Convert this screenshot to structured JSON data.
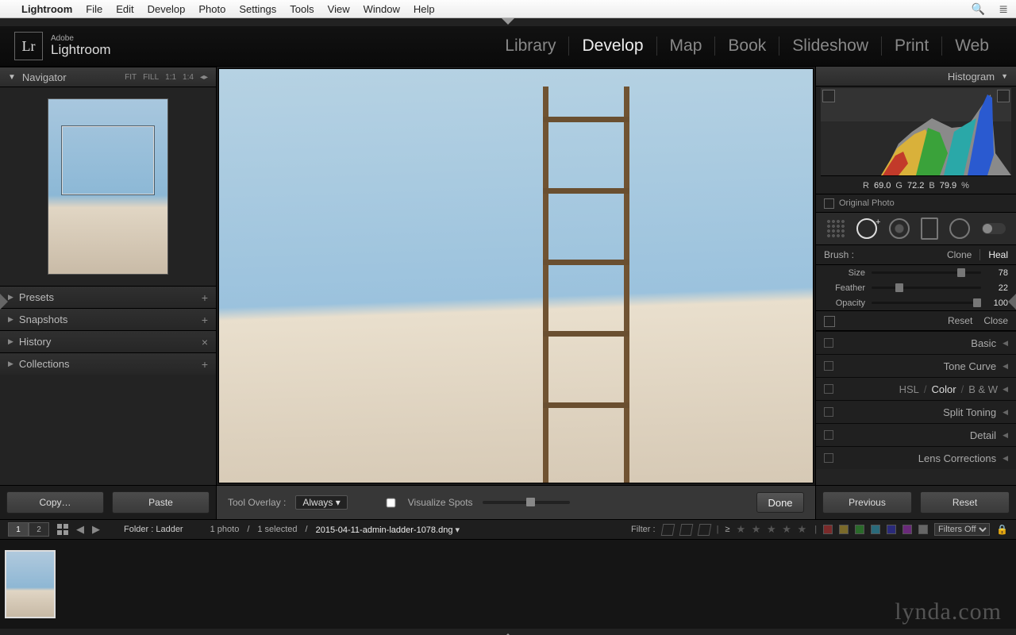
{
  "menubar": {
    "app": "Lightroom",
    "items": [
      "File",
      "Edit",
      "Develop",
      "Photo",
      "Settings",
      "Tools",
      "View",
      "Window",
      "Help"
    ]
  },
  "identity": {
    "adobe": "Adobe",
    "product": "Lightroom",
    "mark": "Lr"
  },
  "modules": [
    "Library",
    "Develop",
    "Map",
    "Book",
    "Slideshow",
    "Print",
    "Web"
  ],
  "modules_active": 1,
  "left": {
    "navigator": {
      "title": "Navigator",
      "zooms": [
        "FIT",
        "FILL",
        "1:1",
        "1:4"
      ]
    },
    "sections": [
      {
        "title": "Presets",
        "end": "+"
      },
      {
        "title": "Snapshots",
        "end": "+"
      },
      {
        "title": "History",
        "end": "×"
      },
      {
        "title": "Collections",
        "end": "+"
      }
    ],
    "copy_btn": "Copy…",
    "paste_btn": "Paste"
  },
  "centerbar": {
    "overlay_label": "Tool Overlay :",
    "overlay_mode": "Always",
    "visualize": "Visualize Spots",
    "done": "Done"
  },
  "right": {
    "histogram_title": "Histogram",
    "rgb": {
      "R_lbl": "R",
      "R": "69.0",
      "G_lbl": "G",
      "G": "72.2",
      "B_lbl": "B",
      "B": "79.9",
      "pct": "%"
    },
    "orig_label": "Original Photo",
    "brush_label": "Brush :",
    "clone": "Clone",
    "heal": "Heal",
    "sliders": [
      {
        "name": "Size",
        "value": "78",
        "pos": 78
      },
      {
        "name": "Feather",
        "value": "22",
        "pos": 22
      },
      {
        "name": "Opacity",
        "value": "100",
        "pos": 100
      }
    ],
    "reset": "Reset",
    "close": "Close",
    "sections": [
      "Basic",
      "Tone Curve",
      "Split Toning",
      "Detail",
      "Lens Corrections"
    ],
    "hsl": {
      "a": "HSL",
      "b": "Color",
      "c": "B & W"
    },
    "prev_btn": "Previous",
    "reset_btn": "Reset"
  },
  "infobar": {
    "view1": "1",
    "view2": "2",
    "folder_lbl": "Folder : Ladder",
    "count": "1 photo",
    "selected": "1 selected",
    "filename": "2015-04-11-admin-ladder-1078.dng",
    "filter_lbl": "Filter :",
    "filters_off": "Filters Off",
    "ge": "≥"
  },
  "watermark": "lynda.com",
  "swatches": [
    "#7a2a2a",
    "#7a6a2a",
    "#2a6a2a",
    "#2a6a7a",
    "#2a2a7a",
    "#6a2a7a",
    "#666"
  ]
}
